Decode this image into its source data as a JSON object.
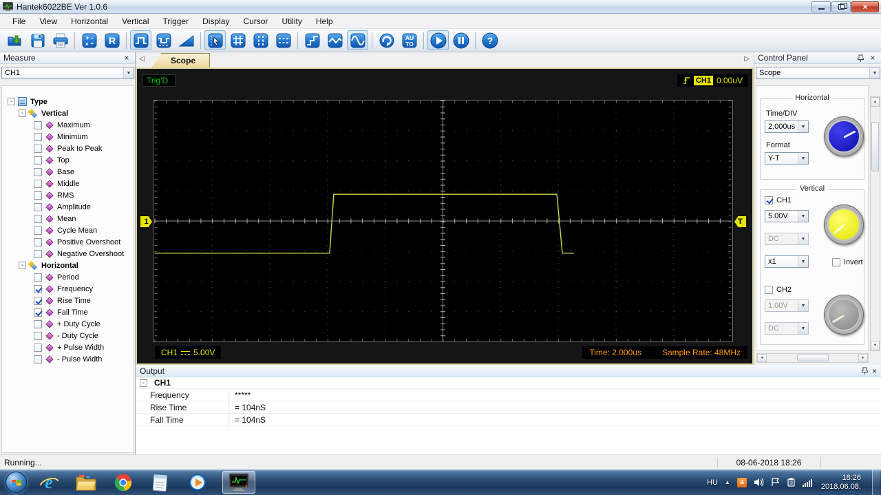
{
  "window": {
    "title": "Hantek6022BE Ver 1.0.6"
  },
  "menu": {
    "items": [
      "File",
      "View",
      "Horizontal",
      "Vertical",
      "Trigger",
      "Display",
      "Cursor",
      "Utility",
      "Help"
    ]
  },
  "toolbar": {
    "icon_names": [
      "open",
      "save",
      "print",
      "math",
      "reference",
      "pulse",
      "pulse-negative",
      "ramp",
      "cursor",
      "grid",
      "vertical-cursors",
      "horizontal-cursors",
      "step-interpolation",
      "linear-interpolation",
      "sine-interpolation",
      "refresh",
      "auto-setup",
      "start",
      "pause",
      "help"
    ],
    "selected_icons": [
      "pulse",
      "cursor",
      "sine-interpolation",
      "start"
    ],
    "reference_letter": "R",
    "math_line1": "+ -",
    "math_line2": "× ÷",
    "auto_line1": "AU",
    "auto_line2": "TO"
  },
  "measure": {
    "title": "Measure",
    "channel": "CH1",
    "tree": {
      "root": "Type",
      "vertical": {
        "label": "Vertical",
        "items": [
          {
            "label": "Maximum",
            "checked": false
          },
          {
            "label": "Minimum",
            "checked": false
          },
          {
            "label": "Peak to Peak",
            "checked": false
          },
          {
            "label": "Top",
            "checked": false
          },
          {
            "label": "Base",
            "checked": false
          },
          {
            "label": "Middle",
            "checked": false
          },
          {
            "label": "RMS",
            "checked": false
          },
          {
            "label": "Amplitude",
            "checked": false
          },
          {
            "label": "Mean",
            "checked": false
          },
          {
            "label": "Cycle Mean",
            "checked": false
          },
          {
            "label": "Positive Overshoot",
            "checked": false
          },
          {
            "label": "Negative Overshoot",
            "checked": false
          }
        ]
      },
      "horizontal": {
        "label": "Horizontal",
        "items": [
          {
            "label": "Period",
            "checked": false
          },
          {
            "label": "Frequency",
            "checked": true
          },
          {
            "label": "Rise Time",
            "checked": true
          },
          {
            "label": "Fall Time",
            "checked": true
          },
          {
            "label": "+ Duty Cycle",
            "checked": false
          },
          {
            "label": "- Duty Cycle",
            "checked": false
          },
          {
            "label": "+ Pulse Width",
            "checked": false
          },
          {
            "label": "- Pulse Width",
            "checked": false
          }
        ]
      }
    }
  },
  "tab": {
    "label": "Scope"
  },
  "scope": {
    "trig_status": "Trig'D",
    "trigger_channel": "CH1",
    "trigger_level": "0.00uV",
    "channel_label": "CH1",
    "volts_div": "5.00V",
    "time_label": "Time: 2.000us",
    "sample_rate_label": "Sample Rate: 48MHz",
    "marker_left": "1",
    "marker_right": "T",
    "waveform_color": "#d6d64e",
    "waveform_points": "0,223 256,223 262,137 588,137 596,223 613,223",
    "divisions": {
      "horizontal": 10,
      "vertical": 8
    }
  },
  "control_panel": {
    "title": "Control Panel",
    "mode": "Scope",
    "horizontal": {
      "group_label": "Horizontal",
      "timediv_label": "Time/DIV",
      "timediv_value": "2.000us",
      "format_label": "Format",
      "format_value": "Y-T",
      "knob_color": "#1414c8"
    },
    "vertical": {
      "group_label": "Vertical",
      "ch1": {
        "label": "CH1",
        "checked": true,
        "volts": "5.00V",
        "coupling": "DC",
        "probe": "x1",
        "invert_label": "Invert",
        "invert_checked": false,
        "knob_color": "#eded10"
      },
      "ch2": {
        "label": "CH2",
        "checked": false,
        "volts": "1.00V",
        "coupling": "DC",
        "knob_color": "#9a9a9a"
      }
    }
  },
  "output": {
    "title": "Output",
    "group": "CH1",
    "rows": [
      {
        "name": "Frequency",
        "value": "*****"
      },
      {
        "name": "Rise Time",
        "value": "= 104nS"
      },
      {
        "name": "Fall Time",
        "value": "= 104nS"
      }
    ]
  },
  "statusbar": {
    "status": "Running...",
    "datetime": "08-06-2018 18:26"
  },
  "taskbar": {
    "language": "HU",
    "clock_time": "18:26",
    "clock_date": "2018.06.08."
  },
  "icons": {
    "close": "×",
    "dropdown": "▼",
    "tab_left": "◁",
    "tab_right": "▷",
    "collapse": "-",
    "scroll_up": "▲",
    "scroll_down": "▼",
    "scroll_left": "◄",
    "scroll_right": "►",
    "tray_expand": "▲"
  }
}
